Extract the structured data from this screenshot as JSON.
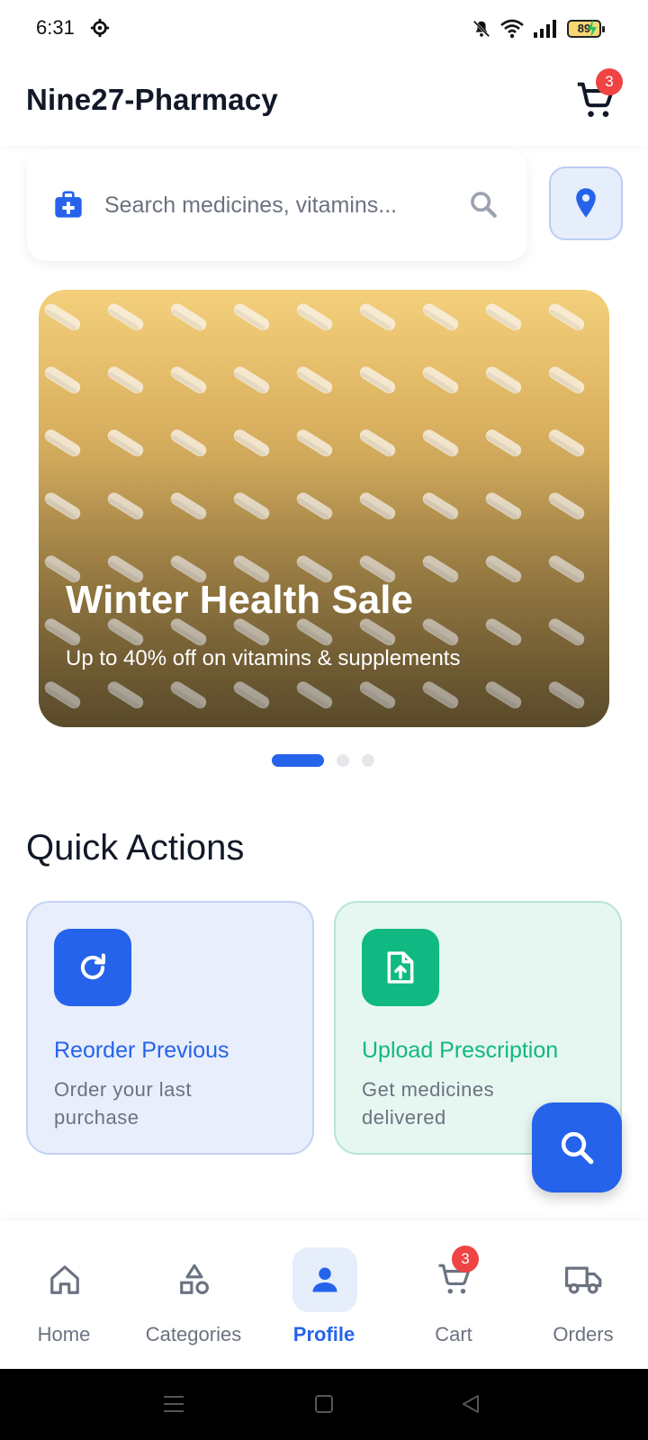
{
  "status_bar": {
    "time": "6:31",
    "battery": "89"
  },
  "app_bar": {
    "title": "Nine27-Pharmacy",
    "cart_badge": "3"
  },
  "search": {
    "placeholder": "Search medicines, vitamins..."
  },
  "banner": {
    "title": "Winter Health Sale",
    "subtitle": "Up to 40% off on vitamins & supplements",
    "slide_count": 3,
    "active_slide": 1
  },
  "quick_actions": {
    "heading": "Quick Actions",
    "items": [
      {
        "title": "Reorder Previous",
        "description": "Order your last purchase",
        "icon": "refresh-icon",
        "color": "#2563eb"
      },
      {
        "title": "Upload Prescription",
        "description": "Get medicines delivered",
        "icon": "file-upload-icon",
        "color": "#10b981"
      }
    ]
  },
  "bottom_nav": {
    "items": [
      {
        "label": "Home",
        "icon": "home-icon"
      },
      {
        "label": "Categories",
        "icon": "categories-icon"
      },
      {
        "label": "Profile",
        "icon": "person-icon",
        "active": true
      },
      {
        "label": "Cart",
        "icon": "cart-icon",
        "badge": "3"
      },
      {
        "label": "Orders",
        "icon": "truck-icon"
      }
    ]
  },
  "colors": {
    "primary": "#2563eb",
    "success": "#10b981",
    "badge": "#ef4444"
  }
}
